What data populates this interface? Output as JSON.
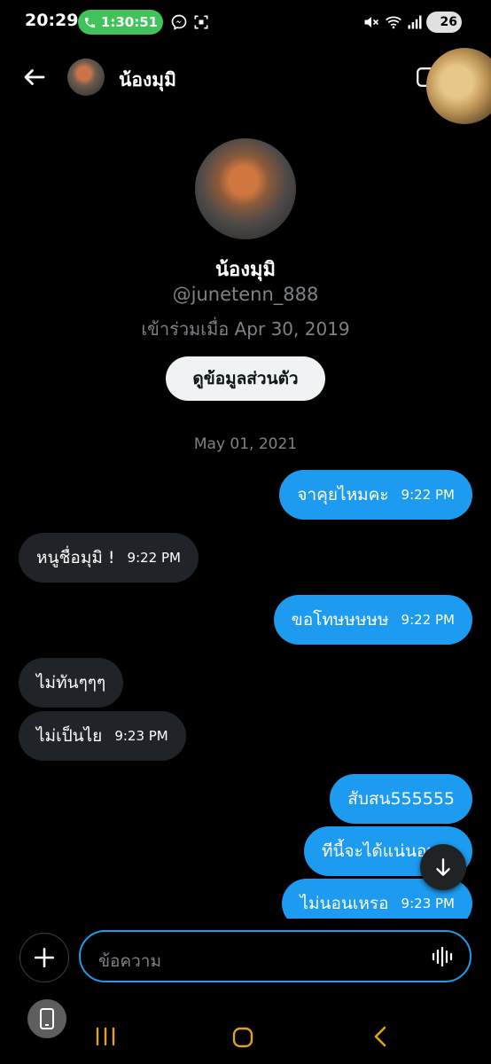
{
  "status_bar": {
    "time": "20:29",
    "call_timer": "1:30:51",
    "battery": "26",
    "icons": [
      "phone-icon",
      "messenger-icon",
      "screenshot-icon",
      "mute-icon",
      "wifi-icon",
      "signal-icon",
      "battery-icon"
    ]
  },
  "header": {
    "name": "น้องมุมิ"
  },
  "profile": {
    "name": "น้องมุมิ",
    "handle": "@junetenn_888",
    "joined": "เข้าร่วมเมื่อ Apr 30, 2019",
    "view_profile_label": "ดูข้อมูลส่วนตัว"
  },
  "date_separator": "May 01, 2021",
  "messages": [
    {
      "dir": "out",
      "text": "จาคุยไหมคะ",
      "time": "9:22 PM"
    },
    {
      "dir": "in",
      "text": "หนูชื่อมุมิ !",
      "time": "9:22 PM"
    },
    {
      "dir": "out",
      "text": "ขอโทษษษษษ",
      "time": "9:22 PM"
    },
    {
      "dir": "in",
      "text": "ไม่ทันๆๆๆ",
      "time": ""
    },
    {
      "dir": "in",
      "text": "ไม่เป็นไย",
      "time": "9:23 PM"
    },
    {
      "dir": "out",
      "text": "สับสน555555",
      "time": ""
    },
    {
      "dir": "out",
      "text": "ทีนี้จะได้แน่นอน",
      "time": ""
    },
    {
      "dir": "out",
      "text": "ไม่นอนเหรอ",
      "time": "9:23 PM"
    }
  ],
  "composer": {
    "placeholder": "ข้อความ"
  },
  "colors": {
    "background": "#000000",
    "outgoing_bubble": "#1d9bf0",
    "incoming_bubble": "#202327",
    "secondary_text": "#7d8287",
    "call_pill": "#3fc35a"
  }
}
